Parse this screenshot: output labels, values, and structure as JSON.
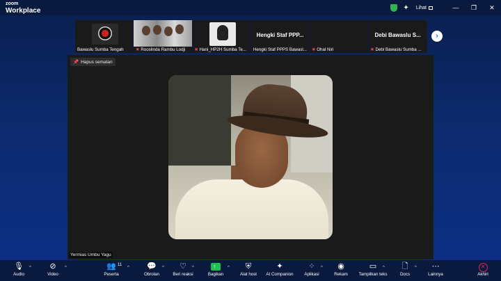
{
  "app": {
    "brand_small": "zoom",
    "brand_big": "Workplace",
    "view_label": "Lihat"
  },
  "colors": {
    "toolbar_bg": "#0a1a3f",
    "share_green": "#1fbf4c",
    "end_red": "#e0245e",
    "accent_blue": "#0b5cff",
    "shield_green": "#2fb34f"
  },
  "participants": [
    {
      "name": "Bawaslu Sumba Tengah",
      "muted": false,
      "view": "logo"
    },
    {
      "name": "Rooslinda Rambu Lodji",
      "muted": true,
      "view": "group-photo"
    },
    {
      "name": "Hani_HP2H Sumba Te...",
      "muted": true,
      "view": "hijab-photo"
    },
    {
      "name": "Hengki Staf PPPS Bawasl...",
      "muted": false,
      "view": "text",
      "display_text": "Hengki Staf PPP..."
    },
    {
      "name": "Ohal Niri",
      "muted": true,
      "view": "blank"
    },
    {
      "name": "Debi Bawaslu Sumba ...",
      "muted": true,
      "view": "text",
      "display_text": "Debi Bawaslu S..."
    }
  ],
  "stage": {
    "unpin_label": "Hapus sematan",
    "speaker_name": "Yermias Umbu Yagu"
  },
  "toolbar": {
    "audio": "Audio",
    "video": "Video",
    "participants": "Peserta",
    "participants_count": "11",
    "chat": "Obrolan",
    "react": "Beri reaksi",
    "share": "Bagikan",
    "host_tools": "Alat host",
    "ai_companion": "AI Companion",
    "apps": "Aplikasi",
    "record": "Rekam",
    "captions": "Tampilkan teks",
    "docs": "Docs",
    "more": "Lainnya",
    "end": "Akhiri"
  }
}
